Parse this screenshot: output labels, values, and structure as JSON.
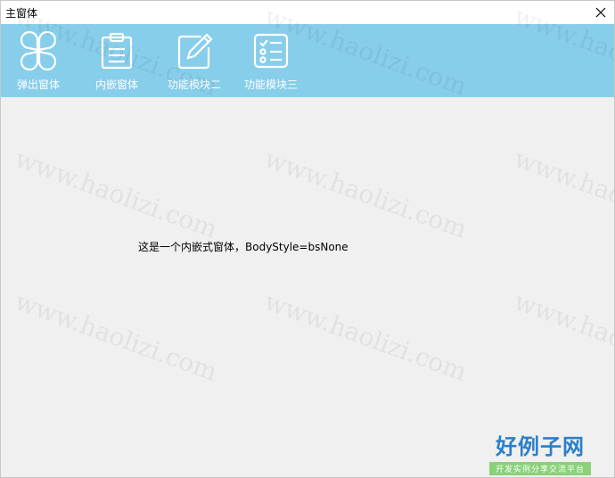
{
  "window": {
    "title": "主窗体"
  },
  "toolbar": {
    "items": [
      {
        "label": "弹出窗体",
        "icon": "clover-icon"
      },
      {
        "label": "内嵌窗体",
        "icon": "clipboard-icon"
      },
      {
        "label": "功能模块二",
        "icon": "edit-icon"
      },
      {
        "label": "功能模块三",
        "icon": "checklist-icon"
      }
    ],
    "background": "#87ceeb"
  },
  "content": {
    "message": "这是一个内嵌式窗体，BodyStyle=bsNone",
    "background": "#f0f0f0"
  },
  "watermark": {
    "text": "www.haolizi.com"
  },
  "logo": {
    "main": "好例子网",
    "sub": "开发实例分享交流平台"
  }
}
